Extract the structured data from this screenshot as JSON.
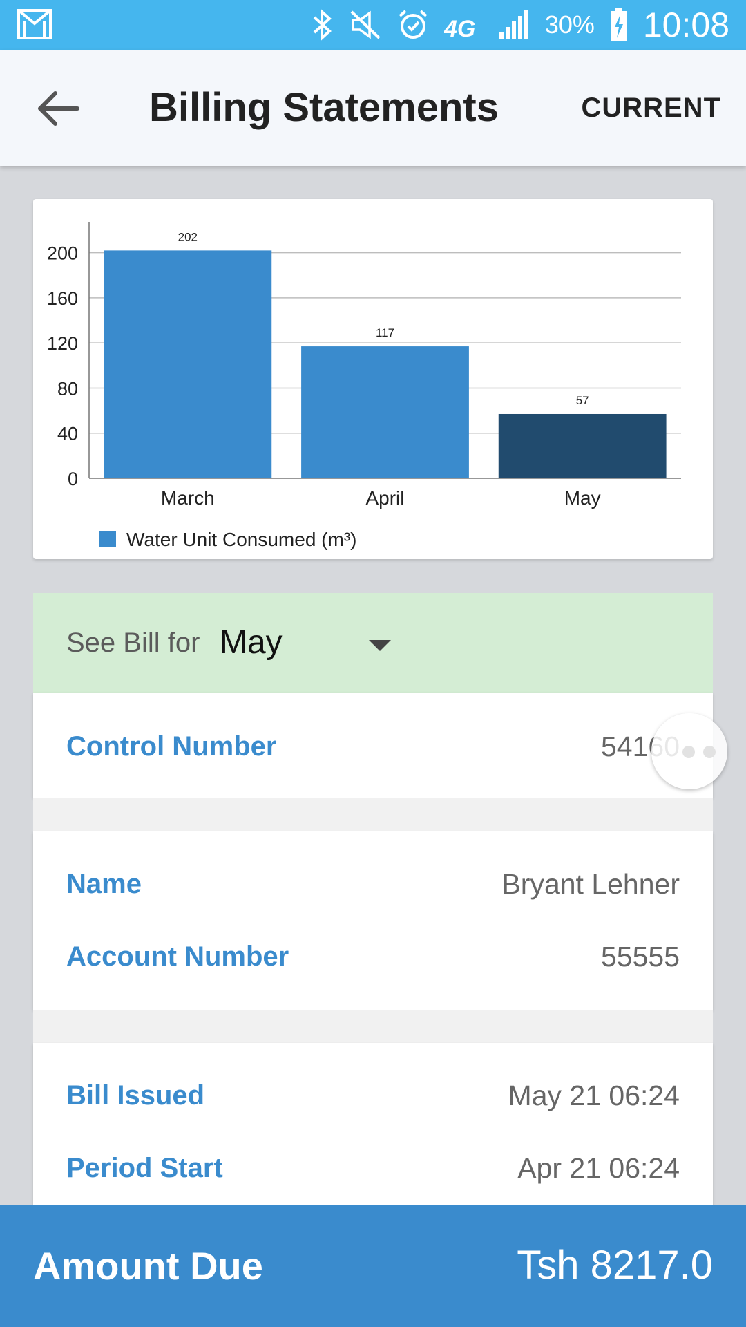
{
  "status_bar": {
    "battery": "30%",
    "time": "10:08",
    "network": "4G",
    "icons": [
      "gmail-icon",
      "bluetooth-icon",
      "mute-icon",
      "alarm-icon",
      "4g-icon",
      "signal-icon",
      "battery-charging-icon"
    ]
  },
  "app_bar": {
    "title": "Billing Statements",
    "action": "CURRENT",
    "back_icon": "arrow-back-icon"
  },
  "chart_data": {
    "type": "bar",
    "categories": [
      "March",
      "April",
      "May"
    ],
    "values": [
      202,
      117,
      57
    ],
    "series": [
      {
        "name": "Water Unit Consumed (m³)",
        "values": [
          202,
          117,
          57
        ]
      }
    ],
    "yticks": [
      0,
      40,
      80,
      120,
      160,
      200
    ],
    "ylim": [
      0,
      220
    ],
    "grid": true,
    "legend_position": "bottom-left",
    "colors": {
      "bar": "#3a8bcd",
      "selected_bar": "#214b6e"
    },
    "selected_category": "May"
  },
  "bill_selector": {
    "label": "See Bill for",
    "selected": "May"
  },
  "control": {
    "label": "Control Number",
    "value": "54160"
  },
  "account": {
    "name_label": "Name",
    "name_value": "Bryant Lehner",
    "number_label": "Account Number",
    "number_value": "55555"
  },
  "dates": {
    "issued_label": "Bill Issued",
    "issued_value": "May 21 06:24",
    "period_start_label": "Period Start",
    "period_start_value": "Apr 21 06:24"
  },
  "footer": {
    "label": "Amount Due",
    "value": "Tsh 8217.0"
  },
  "colors": {
    "status_bar": "#45b6ee",
    "accent": "#3a8bcd",
    "selector_bg": "#d4edd4"
  }
}
